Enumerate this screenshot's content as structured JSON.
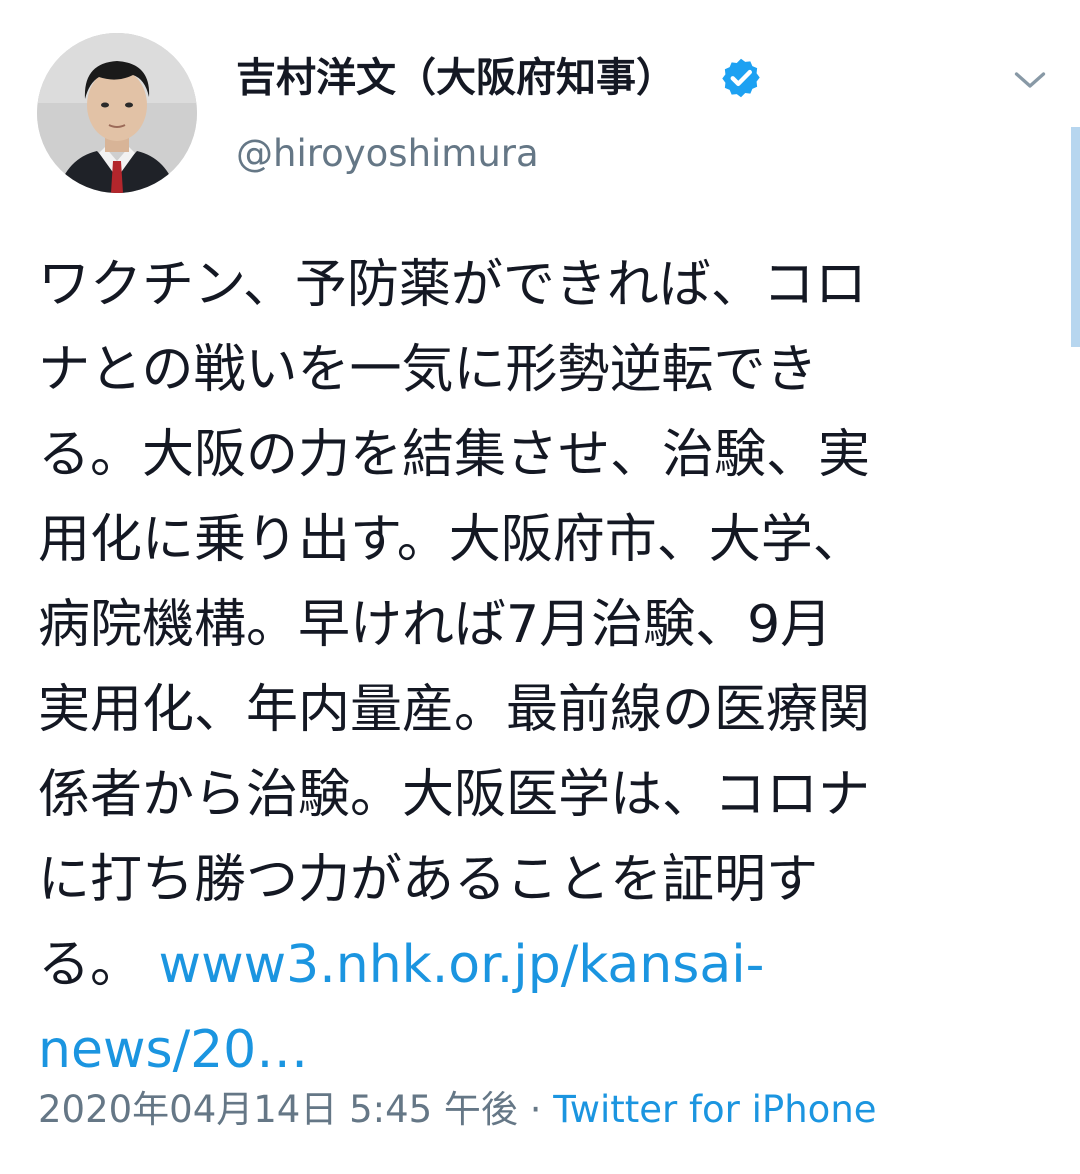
{
  "tweet": {
    "author": {
      "display_name": "吉村洋文（大阪府知事）",
      "handle": "@hiroyoshimura",
      "verified_icon": "verified-badge-icon"
    },
    "menu_icon": "chevron-down-icon",
    "text_lines": [
      "ワクチン、予防薬ができれば、コロ",
      "ナとの戦いを一気に形勢逆転でき",
      "る。大阪の力を結集させ、治験、実",
      "用化に乗り出す。大阪府市、大学、",
      "病院機構。早ければ7月治験、9月",
      "実用化、年内量産。最前線の医療関",
      "係者から治験。大阪医学は、コロナ",
      "に打ち勝つ力があることを証明す"
    ],
    "last_line_prefix": "る。",
    "link_line1": "www3.nhk.or.jp/kansai-",
    "link_line2": "news/20…",
    "timestamp": "2020年04月14日 5:45 午後",
    "separator": "·",
    "source": "Twitter for iPhone"
  },
  "colors": {
    "link": "#1b95e0",
    "verified": "#1da1f2",
    "secondary_text": "#657786",
    "primary_text": "#141823"
  }
}
